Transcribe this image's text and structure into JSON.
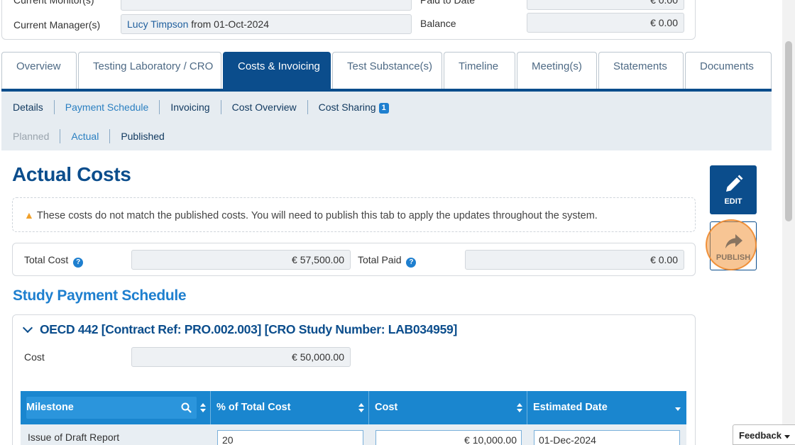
{
  "info": {
    "current_monitor_label": "Current Monitor(s)",
    "current_manager_label": "Current Manager(s)",
    "current_manager_name": "Lucy Timpson",
    "current_manager_suffix": " from 01-Oct-2024",
    "paid_to_date_label": "Paid to Date",
    "paid_to_date_value": "€ 0.00",
    "balance_label": "Balance",
    "balance_value": "€ 0.00"
  },
  "tabs": [
    {
      "label": "Overview"
    },
    {
      "label": "Testing Laboratory / CRO"
    },
    {
      "label": "Costs & Invoicing",
      "active": true
    },
    {
      "label": "Test Substance(s)"
    },
    {
      "label": "Timeline"
    },
    {
      "label": "Meeting(s)"
    },
    {
      "label": "Statements"
    },
    {
      "label": "Documents"
    }
  ],
  "subnav": {
    "row1": [
      "Details",
      "Payment Schedule",
      "Invoicing",
      "Cost Overview",
      "Cost Sharing"
    ],
    "cost_sharing_badge": "1",
    "row2": [
      "Planned",
      "Actual",
      "Published"
    ]
  },
  "main": {
    "title": "Actual Costs",
    "warning": "These costs do not match the published costs. You will need to publish this tab to apply the updates throughout the system.",
    "total_cost_label": "Total Cost",
    "total_cost_value": "€ 57,500.00",
    "total_paid_label": "Total Paid",
    "total_paid_value": "€ 0.00",
    "section_title": "Study Payment Schedule"
  },
  "study": {
    "heading": "OECD 442 [Contract Ref: PRO.002.003] [CRO Study Number: LAB034959]",
    "cost_label": "Cost",
    "cost_value": "€ 50,000.00",
    "columns": [
      "Milestone",
      "% of Total Cost",
      "Cost",
      "Estimated Date"
    ],
    "rows": [
      {
        "milestone": "Issue of Draft Report",
        "percent": "20",
        "cost": "€ 10,000.00",
        "date": "01-Dec-2024"
      }
    ]
  },
  "actions": {
    "edit_label": "EDIT",
    "publish_label": "PUBLISH"
  },
  "feedback_label": "Feedback",
  "colors": {
    "primary": "#0b4d8c",
    "accent": "#1e7fcf",
    "warning": "#f0a02a",
    "highlight": "#f0963c"
  }
}
